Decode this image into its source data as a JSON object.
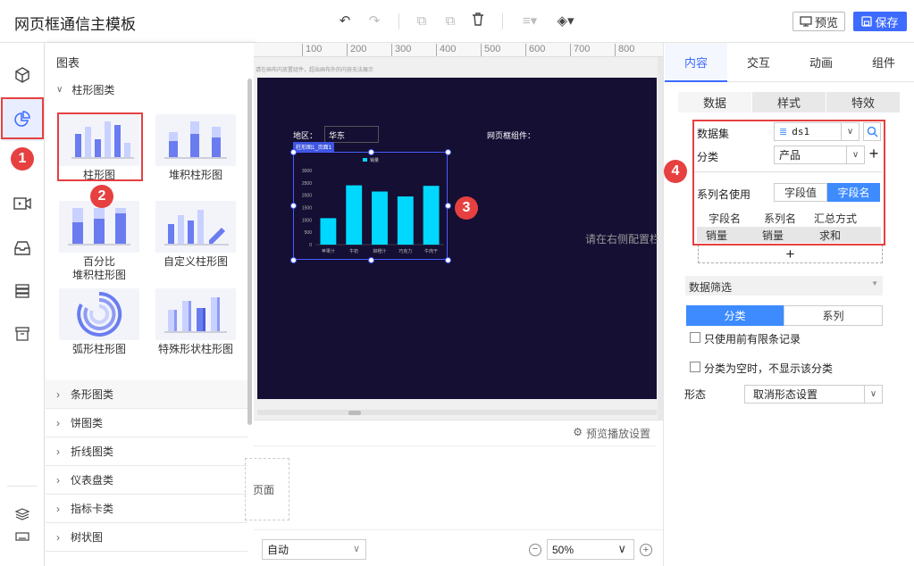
{
  "header": {
    "title": "网页框通信主模板",
    "preview_label": "预览",
    "save_label": "保存"
  },
  "left_panel": {
    "title": "图表",
    "open_category": "柱形图类",
    "charts": [
      {
        "name": "柱形图"
      },
      {
        "name": "堆积柱形图"
      },
      {
        "name": "百分比\n堆积柱形图"
      },
      {
        "name": "自定义柱形图"
      },
      {
        "name": "弧形柱形图"
      },
      {
        "name": "特殊形状柱形图"
      }
    ],
    "categories": [
      "条形图类",
      "饼图类",
      "折线图类",
      "仪表盘类",
      "指标卡类",
      "树状图"
    ]
  },
  "ruler": {
    "ticks": [
      "100",
      "200",
      "300",
      "400",
      "500",
      "600",
      "700",
      "800"
    ]
  },
  "canvas": {
    "hint": "请在画布内放置组件，超出画布外的内容无法展示",
    "region_label": "地区：",
    "region_value": "华东",
    "frame_label": "网页框组件：",
    "widget_tag": "柱形图1_页面1",
    "right_hint": "请在右侧配置栏"
  },
  "chart_data": {
    "type": "bar",
    "categories": [
      "苹果汁",
      "牛奶",
      "柳橙汁",
      "巧克力",
      "牛肉干"
    ],
    "series": [
      {
        "name": "销量",
        "values": [
          1070,
          2400,
          2150,
          1950,
          2380
        ]
      }
    ],
    "ylim": [
      0,
      3000
    ],
    "yticks": [
      0,
      500,
      1000,
      1500,
      2000,
      2500,
      3000
    ],
    "legend": "top-center",
    "colors": {
      "bar": "#00d8ff"
    }
  },
  "lower": {
    "settings_label": "预览播放设置",
    "page_label": "页面",
    "auto_select": "自动",
    "zoom": "50%"
  },
  "right_panel": {
    "tabs": [
      "内容",
      "交互",
      "动画",
      "组件"
    ],
    "subtabs": [
      "数据",
      "样式",
      "特效"
    ],
    "dataset_label": "数据集",
    "dataset_value": "ds1",
    "category_label": "分类",
    "category_value": "产品",
    "series_name_label": "系列名使用",
    "series_toggle": [
      "字段值",
      "字段名"
    ],
    "table_headers": [
      "字段名",
      "系列名",
      "汇总方式"
    ],
    "table_row": [
      "销量",
      "销量",
      "求和"
    ],
    "filter_label": "数据筛选",
    "filter_toggle": [
      "分类",
      "系列"
    ],
    "limit_label": "只使用前有限条记录",
    "empty_label": "分类为空时，不显示该分类",
    "shape_label": "形态",
    "shape_value": "取消形态设置"
  },
  "badges": [
    "1",
    "2",
    "3",
    "4"
  ],
  "colors": {
    "accent": "#3d6bff",
    "annotation": "#e64040",
    "canvas_bg": "#140f33"
  }
}
